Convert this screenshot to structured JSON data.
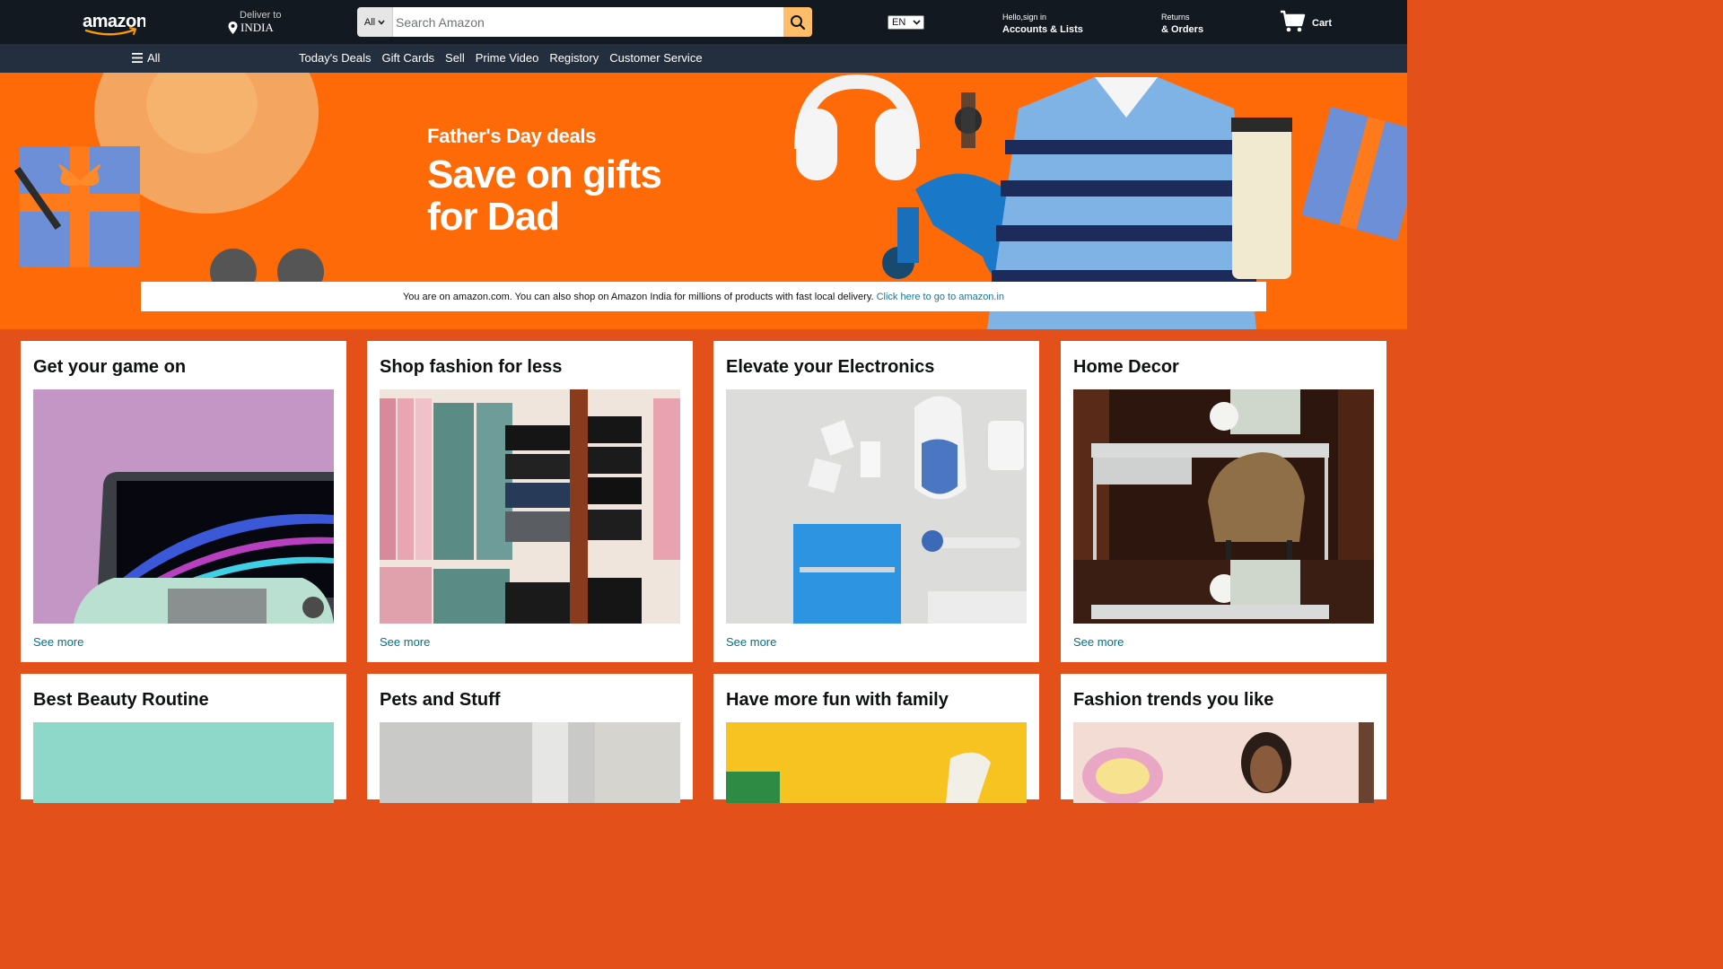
{
  "header": {
    "deliver_small": "Deliver to",
    "deliver_location": "INDIA",
    "search_category": "All",
    "search_placeholder": "Search Amazon",
    "language": "EN",
    "account_small": "Hello,sign in",
    "account_big": "Accounts & Lists",
    "returns_small": "Returns",
    "returns_big": "& Orders",
    "cart_label": "Cart"
  },
  "subnav": {
    "all_label": "All",
    "links": [
      "Today's Deals",
      "Gift Cards",
      "Sell",
      "Prime Video",
      "Registory",
      "Customer Service"
    ]
  },
  "hero": {
    "kicker": "Father's Day deals",
    "title_line1": "Save on gifts",
    "title_line2": "for Dad",
    "notice_text": "You are on amazon.com. You can also shop on Amazon India for millions of products with fast local delivery.",
    "notice_link": "Click here to go to amazon.in"
  },
  "cards": [
    {
      "title": "Get your game on",
      "link": "See more"
    },
    {
      "title": "Shop fashion for less",
      "link": "See more"
    },
    {
      "title": "Elevate your Electronics",
      "link": "See more"
    },
    {
      "title": "Home Decor",
      "link": "See more"
    },
    {
      "title": "Best Beauty Routine"
    },
    {
      "title": "Pets and Stuff"
    },
    {
      "title": "Have more fun with family"
    },
    {
      "title": "Fashion trends you like"
    }
  ],
  "colors": {
    "topbar": "#131921",
    "subnav": "#232f3e",
    "hero_orange": "#ff6a08",
    "page_background": "#e3501a",
    "search_button": "#febd69",
    "link": "#007185"
  }
}
